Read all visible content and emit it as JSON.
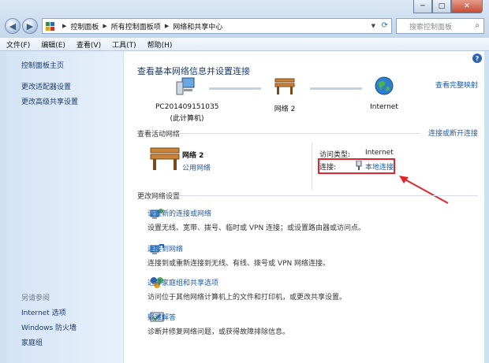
{
  "window": {
    "min_label": "─",
    "max_label": "□",
    "close_label": "✕"
  },
  "address": {
    "crumbs": [
      "控制面板",
      "所有控制面板项",
      "网络和共享中心"
    ],
    "search_placeholder": "搜索控制面板"
  },
  "menu": [
    "文件(F)",
    "编辑(E)",
    "查看(V)",
    "工具(T)",
    "帮助(H)"
  ],
  "sidebar": {
    "home": "控制面板主页",
    "adapter": "更改适配器设置",
    "sharing": "更改高级共享设置",
    "see_also": "另请参阅",
    "also": [
      "Internet 选项",
      "Windows 防火墙",
      "家庭组"
    ]
  },
  "main": {
    "heading": "查看基本网络信息并设置连接",
    "view_full_map": "查看完整映射",
    "nodes": {
      "pc_name": "PC201409151035",
      "pc_sub": "(此计算机)",
      "network": "网络  2",
      "internet": "Internet"
    },
    "active_title": "查看活动网络",
    "connect_disconnect": "连接或断开连接",
    "active": {
      "name": "网络  2",
      "type": "公用网络",
      "access_label": "访问类型:",
      "access_value": "Internet",
      "conn_label": "连接:",
      "conn_value": "本地连接"
    },
    "change_title": "更改网络设置",
    "tasks": [
      {
        "title": "设置新的连接或网络",
        "desc": "设置无线、宽带、拨号、临时或 VPN 连接；或设置路由器或访问点。"
      },
      {
        "title": "连接到网络",
        "desc": "连接到或重新连接到无线、有线、拨号或 VPN 网络连接。"
      },
      {
        "title": "选择家庭组和共享选项",
        "desc": "访问位于其他网络计算机上的文件和打印机，或更改共享设置。"
      },
      {
        "title": "疑难解答",
        "desc": "诊断并修复网络问题，或获得故障排除信息。"
      }
    ]
  },
  "colors": {
    "link": "#1f59a8",
    "annotation_red": "#e3242b"
  }
}
